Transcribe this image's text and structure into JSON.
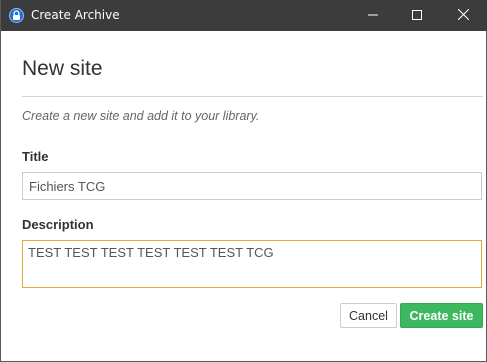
{
  "window": {
    "title": "Create Archive",
    "controls": {
      "minimize": "minimize-icon",
      "maximize": "maximize-icon",
      "close": "close-icon"
    }
  },
  "dialog": {
    "heading": "New site",
    "subtitle": "Create a new site and add it to your library.",
    "title_label": "Title",
    "title_value": "Fichiers TCG",
    "description_label": "Description",
    "description_value": "TEST TEST TEST TEST TEST TEST TCG",
    "cancel_label": "Cancel",
    "create_label": "Create site"
  },
  "colors": {
    "titlebar": "#3c3c3c",
    "accent_focus": "#e6a63c",
    "primary_button": "#3cb95f"
  }
}
